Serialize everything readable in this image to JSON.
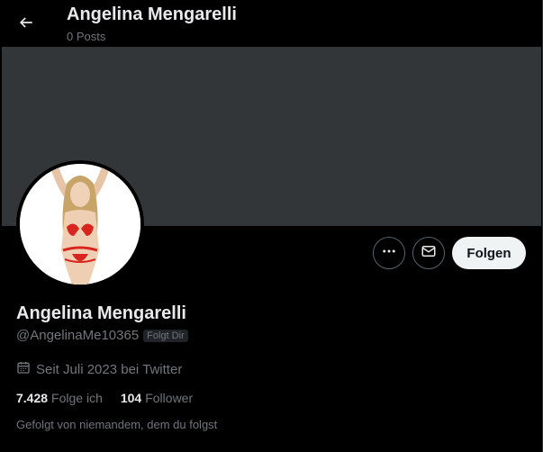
{
  "header": {
    "title": "Angelina Mengarelli",
    "posts_count": "0 Posts"
  },
  "profile": {
    "name": "Angelina Mengarelli",
    "handle": "@AngelinaMe10365",
    "follows_you_badge": "Folgt Dir",
    "joined": "Seit Juli 2023 bei Twitter",
    "following_count": "7.428",
    "following_label": "Folge ich",
    "followers_count": "104",
    "followers_label": "Follower",
    "followed_by": "Gefolgt von niemandem, dem du folgst"
  },
  "actions": {
    "follow_label": "Folgen"
  },
  "icons": {
    "back": "arrow-left-icon",
    "more": "more-horizontal-icon",
    "message": "envelope-icon",
    "calendar": "calendar-icon"
  },
  "colors": {
    "background": "#000000",
    "banner": "#333639",
    "text_primary": "#e7e9ea",
    "text_secondary": "#71767b",
    "follow_button_bg": "#eff3f4",
    "follow_button_text": "#0f1419"
  }
}
